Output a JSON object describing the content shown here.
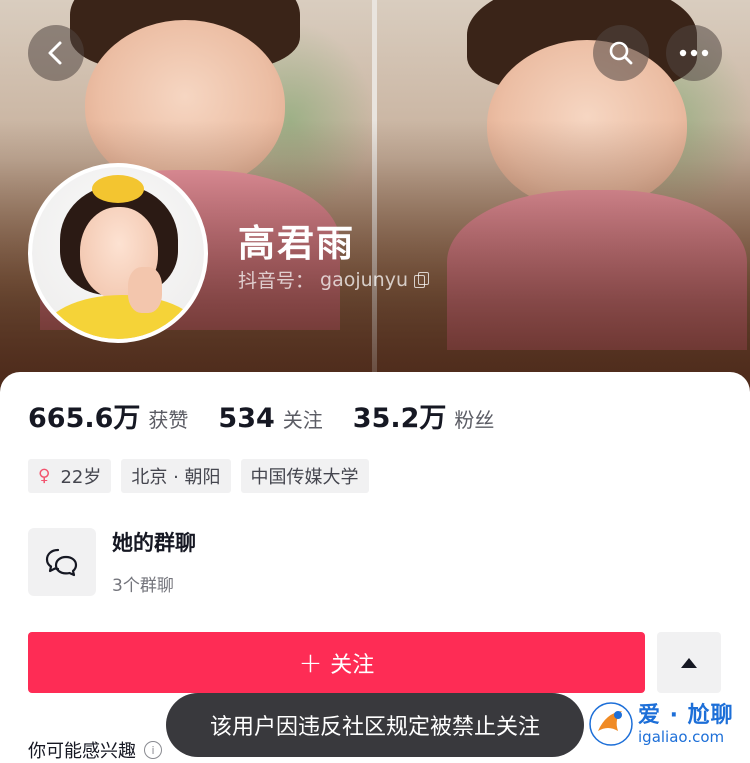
{
  "profile": {
    "name": "高君雨",
    "douyin_id_label": "抖音号：",
    "douyin_id": "gaojunyu"
  },
  "stats": [
    {
      "value": "665.6万",
      "label": "获赞"
    },
    {
      "value": "534",
      "label": "关注"
    },
    {
      "value": "35.2万",
      "label": "粉丝"
    }
  ],
  "tags": {
    "age": "22岁",
    "location": "北京 · 朝阳",
    "school": "中国传媒大学"
  },
  "group_chat": {
    "title": "她的群聊",
    "subtitle": "3个群聊",
    "icon": "chat-bubbles-icon"
  },
  "actions": {
    "follow_plus": "+",
    "follow_label": "关注"
  },
  "suggest": {
    "label": "你可能感兴趣",
    "info_symbol": "i"
  },
  "toast": {
    "message": "该用户因违反社区规定被禁止关注"
  },
  "watermark": {
    "title": "爱 · 尬聊",
    "url": "igaliao.com"
  },
  "colors": {
    "follow_button": "#fe2c55",
    "female_icon": "#f2546f",
    "watermark": "#1d6fd8"
  }
}
